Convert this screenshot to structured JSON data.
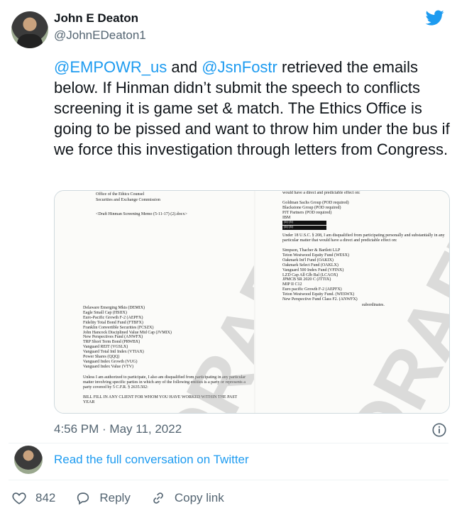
{
  "author": {
    "name": "John E Deaton",
    "handle": "@JohnEDeaton1"
  },
  "tweet": {
    "mention1": "@EMPOWR_us",
    "text_and": " and ",
    "mention2": "@JsnFostr",
    "text_body": " retrieved the emails below. If Hinman didn’t submit the speech to conflicts screening it is game set & match. The Ethics Office is going to be pissed and want to throw him under the bus if we force this investigation through letters from Congress."
  },
  "media": {
    "left_page": {
      "header_lines": [
        "Office of the Ethics Counsel",
        "Securities and Exchange Commission"
      ],
      "subject": "<Draft Hinman Screening Memo (5-11-17) (2).docx>",
      "list": [
        "Delaware Emerging Mkts (DEMIX)",
        "Eagle Small Cap (HSIIX)",
        "Euro-Pacific Growth F-2 (AEPFX)",
        "Fidelity Total Bond Fund (FTBFX)",
        "Franklin Convertible Securities (FCSZX)",
        "John Hancock Disciplined Value Mid Cap (JVMIX)",
        "New Perspectives Fund (ANWFX)",
        "TRP Short Term Bond (PRWBX)",
        "Vanguard REIT (VGSLX)",
        "Vanguard Total Intl Index (VTIAX)",
        "Power Shares (QQQ)",
        "Vanguard Index Growth (VUG)",
        "Vanguard Index Value (VTV)"
      ],
      "para": [
        "Unless I am authorized to participate, I also am disqualified from participating in any particular",
        "matter involving specific parties in which any of the following entities is a party or represents a",
        "party covered by 5 C.F.R. § 2635.502:"
      ],
      "fill": [
        "BILL FILL IN ANY CLIENT FOR WHOM YOU HAVE WORKED WITHIN THE PAST",
        "YEAR"
      ],
      "watermark": "DRAFT"
    },
    "right_page": {
      "top_line": "would have a direct and predictable effect on:",
      "list1": [
        "Goldman Sachs Group (POD required)",
        "Blackstone Group (POD required)",
        "PJT Partners (POD required)",
        "IBM"
      ],
      "redact_labels": [
        "(b) (6)",
        "(b) (6)"
      ],
      "para": [
        "Under 18 U.S.C. § 208, I am disqualified from participating personally and substantially in any",
        "particular matter that would have a direct and predictable effect on:"
      ],
      "list2": [
        "Simpson, Thacher & Bartlett LLP",
        "Teton Westwood Equity Fund (WESX)",
        "Oakmark Int'l Fund (OAKIX)",
        "Oakmark Select Fund (OAKLX)",
        "Vanguard 500 Index Fund (VFINX)",
        "LZD Cap All Glb Bal (LCAOX)",
        "JPMCB SR 2020 C    (JTTIX)",
        "MIP II C12",
        "Euro pacific Growth F-2  (AEPFX)",
        "Teton Westwood Equity Fund. (WESWX)",
        "New Perspective Fund Class F2. (ANWFX)"
      ],
      "tail": [
        "subordinates."
      ],
      "watermark": "DRAFT"
    }
  },
  "meta": {
    "time": "4:56 PM",
    "separator": " · ",
    "date": "May 11, 2022"
  },
  "conversation": {
    "link_label": "Read the full conversation on Twitter"
  },
  "actions": {
    "like_count": "842",
    "reply_label": "Reply",
    "copy_label": "Copy link"
  },
  "colors": {
    "accent": "#1d9bf0",
    "secondary_text": "#536471",
    "like_icon": "#536471"
  }
}
